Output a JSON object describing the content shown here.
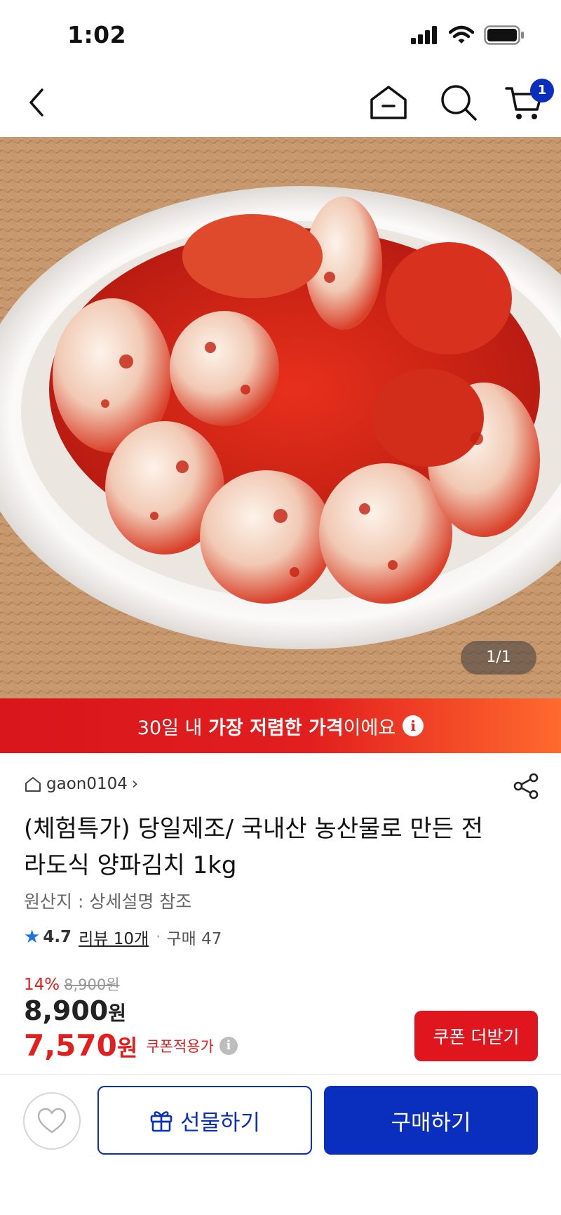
{
  "status_bar": {
    "time": "1:02"
  },
  "nav": {
    "cart_count": "1"
  },
  "hero": {
    "image_counter": "1/1"
  },
  "promo_banner": {
    "prefix": "30일 내 ",
    "highlight": "가장 저렴한 가격",
    "suffix": "이에요",
    "info_glyph": "i"
  },
  "seller": {
    "name": "gaon0104",
    "chevron": "›"
  },
  "product": {
    "title": "(체험특가) 당일제조/ 국내산 농산물로 만든 전라도식 양파김치 1kg",
    "origin": "원산지 : 상세설명 참조"
  },
  "rating": {
    "star": "★",
    "score": "4.7",
    "reviews": "리뷰 10개",
    "dot": "·",
    "purchases": "구매 47"
  },
  "price": {
    "discount_rate": "14%",
    "original": "8,900원",
    "sale_amount": "8,900",
    "sale_unit": "원",
    "coupon_amount": "7,570",
    "coupon_unit": "원",
    "coupon_label": "쿠폰적용가",
    "coupon_info_glyph": "i"
  },
  "coupon_button": {
    "label": "쿠폰 더받기"
  },
  "bottom_bar": {
    "gift_label": "선물하기",
    "buy_label": "구매하기"
  },
  "colors": {
    "accent_blue": "#0a2fbf",
    "accent_red": "#e21e1e"
  },
  "icons": [
    "back-icon",
    "home-icon",
    "search-icon",
    "cart-icon",
    "share-icon",
    "home-small-icon",
    "heart-icon",
    "gift-icon",
    "signal-icon",
    "wifi-icon",
    "battery-icon"
  ]
}
